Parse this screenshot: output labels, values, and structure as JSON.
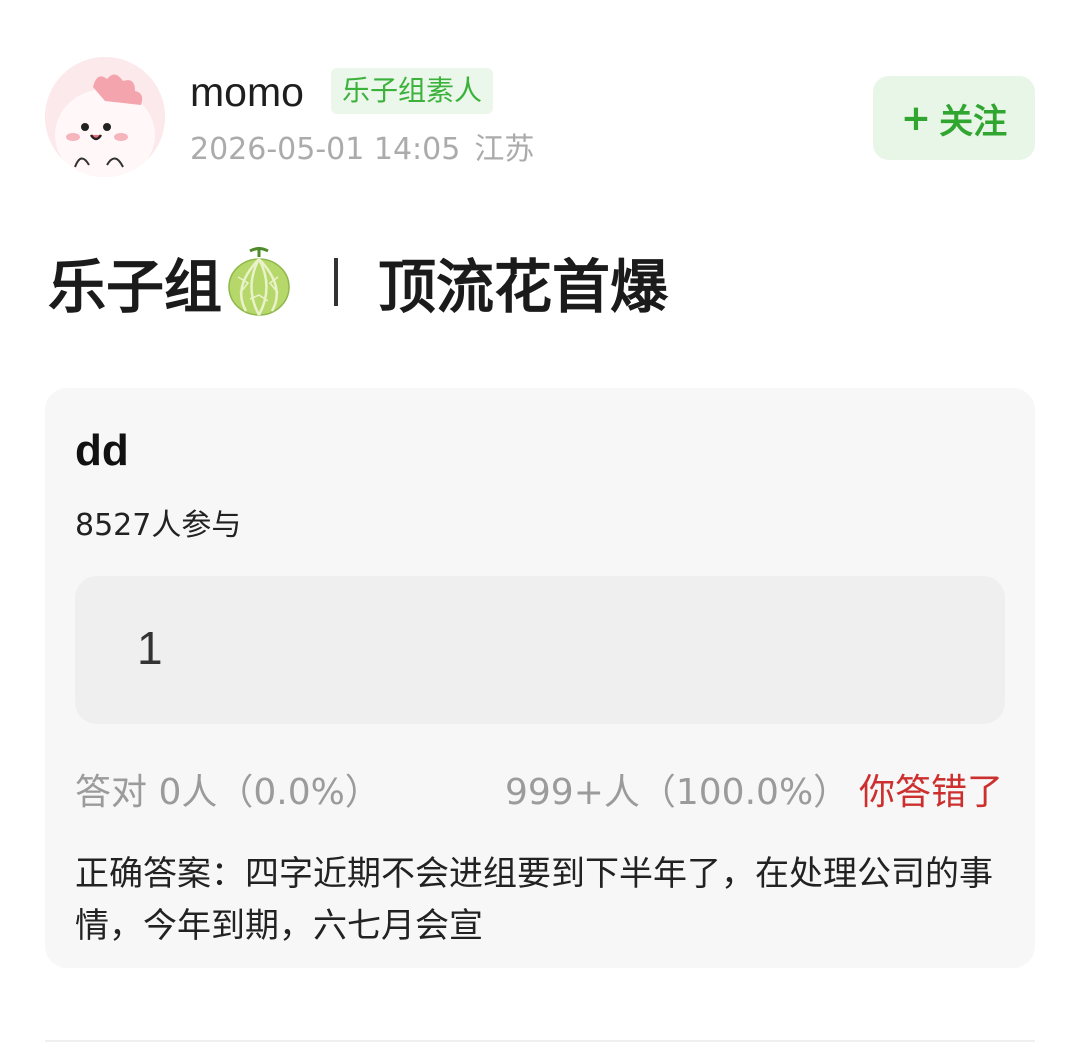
{
  "header": {
    "username": "momo",
    "badge": "乐子组素人",
    "timestamp": "2026-05-01 14:05",
    "location": "江苏",
    "follow_plus": "+",
    "follow_label": "关注"
  },
  "post": {
    "title_left": "乐子组",
    "title_icon": "melon-emoji",
    "title_right": "顶流花首爆"
  },
  "quiz": {
    "title": "dd",
    "participants": "8527人参与",
    "option_label": "1",
    "correct_stat": "答对  0人（0.0%）",
    "wrong_stat": "999+人（100.0%）",
    "verdict": "你答错了",
    "answer": "正确答案：四字近期不会进组要到下半年了，在处理公司的事情，今年到期，六七月会宣"
  },
  "colors": {
    "badge_text": "#3cb13c",
    "badge_bg": "#eaf7ea",
    "follow_text": "#30a530",
    "follow_bg": "#e7f6e7",
    "wrong_red": "#cd2f2f",
    "card_bg": "#f7f7f7"
  }
}
